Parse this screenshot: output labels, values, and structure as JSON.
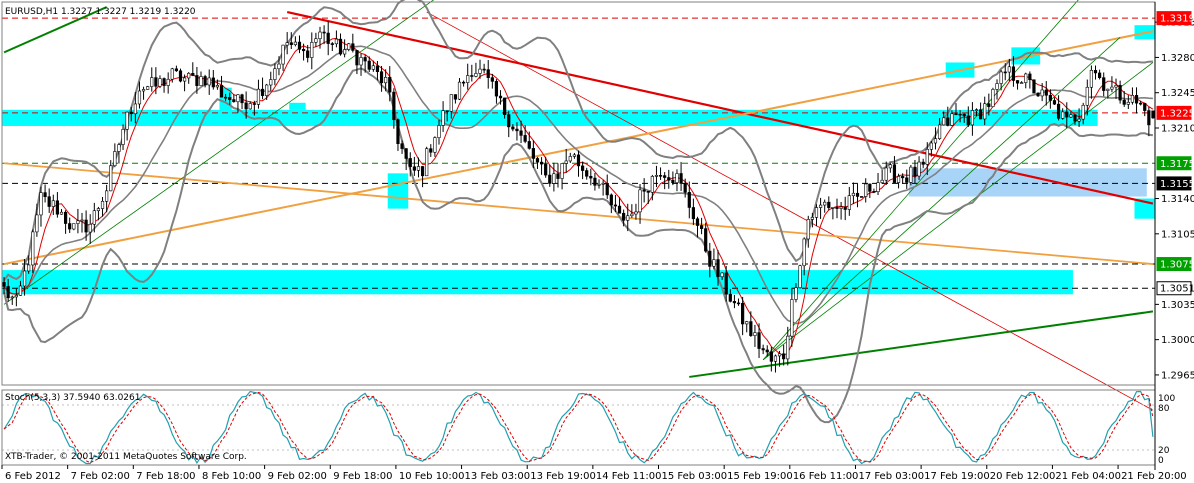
{
  "header": {
    "symbol_info": "EURUSD,H1 1.3227 1.3227 1.3219 1.3220"
  },
  "stoch_panel": {
    "label": "Stoch(5,3,3) 37.5940 63.0261",
    "levels": [
      "100",
      "80",
      "20",
      "0"
    ]
  },
  "copyright": "XTB-Trader, © 2001-2011 MetaQuotes Software Corp.",
  "colors": {
    "background": "#ffffff",
    "candle": "#000000",
    "bollinger": "#808080",
    "ma": "#e00000",
    "zone": "#00ffff",
    "zone_blue": "#a8d4f8",
    "trend_red": "#e00000",
    "trend_orange": "#f0a040",
    "trend_green": "#008000",
    "tag_red": "#ff0000",
    "tag_green": "#00a000",
    "tag_black": "#000000",
    "stoch_main": "#20a0b0",
    "stoch_signal": "#e00000"
  },
  "chart_data": {
    "type": "candlestick",
    "title": "EURUSD,H1",
    "x_axis": {
      "type": "time",
      "tick_labels": [
        "6 Feb 2012",
        "7 Feb 02:00",
        "7 Feb 18:00",
        "8 Feb 10:00",
        "9 Feb 02:00",
        "9 Feb 18:00",
        "10 Feb 10:00",
        "13 Feb 03:00",
        "13 Feb 19:00",
        "14 Feb 11:00",
        "15 Feb 03:00",
        "15 Feb 19:00",
        "16 Feb 11:00",
        "17 Feb 03:00",
        "17 Feb 19:00",
        "20 Feb 12:00",
        "21 Feb 04:00",
        "21 Feb 20:00"
      ],
      "ticks_per_label": 16
    },
    "y_axis": {
      "tick_labels": [
        "1.3315",
        "1.3280",
        "1.3245",
        "1.3210",
        "1.3140",
        "1.3105",
        "1.3035",
        "1.3000",
        "1.2965"
      ],
      "range": [
        1.2955,
        1.3335
      ]
    },
    "last": {
      "open": 1.3227,
      "high": 1.3227,
      "low": 1.3219,
      "close": 1.322
    },
    "price_markers": [
      {
        "label": "1.3319",
        "style": "red"
      },
      {
        "label": "1.3225",
        "style": "red"
      },
      {
        "label": "1.3175",
        "style": "green"
      },
      {
        "label": "1.3155",
        "style": "black"
      },
      {
        "label": "1.3075",
        "style": "green"
      },
      {
        "label": "1.3051",
        "style": "black-outline"
      }
    ],
    "horizontal_lines": [
      {
        "price": 1.3319,
        "color": "red",
        "style": "dashed"
      },
      {
        "price": 1.3225,
        "color": "red",
        "style": "dashed"
      },
      {
        "price": 1.3175,
        "color": "green",
        "style": "dashed"
      },
      {
        "price": 1.3155,
        "color": "black",
        "style": "dashed"
      },
      {
        "price": 1.3075,
        "color": "black",
        "style": "dashed"
      },
      {
        "price": 1.3051,
        "color": "black",
        "style": "dashed"
      }
    ],
    "zones": [
      {
        "from_bar": 0,
        "to_bar": 266,
        "low": 1.3212,
        "high": 1.3228,
        "color": "zone"
      },
      {
        "from_bar": 0,
        "to_bar": 260,
        "low": 1.3045,
        "high": 1.3069,
        "color": "zone"
      },
      {
        "from_bar": 221,
        "to_bar": 278,
        "low": 1.3142,
        "high": 1.317,
        "color": "zone_blue"
      },
      {
        "from_bar": 53,
        "to_bar": 55,
        "low": 1.3212,
        "high": 1.325,
        "color": "zone"
      },
      {
        "from_bar": 70,
        "to_bar": 73,
        "low": 1.3228,
        "high": 1.3235,
        "color": "zone"
      },
      {
        "from_bar": 94,
        "to_bar": 98,
        "low": 1.313,
        "high": 1.3165,
        "color": "zone"
      },
      {
        "from_bar": 230,
        "to_bar": 236,
        "low": 1.326,
        "high": 1.3275,
        "color": "zone"
      },
      {
        "from_bar": 246,
        "to_bar": 252,
        "low": 1.3273,
        "high": 1.329,
        "color": "zone"
      },
      {
        "from_bar": 276,
        "to_bar": 280,
        "low": 1.3298,
        "high": 1.3312,
        "color": "zone"
      },
      {
        "from_bar": 276,
        "to_bar": 280,
        "low": 1.312,
        "high": 1.314,
        "color": "zone"
      }
    ],
    "trend_lines": [
      {
        "b1": 69,
        "p1": 1.3325,
        "b2": 280,
        "p2": 1.3135,
        "color": "trend_red",
        "width": 2.2
      },
      {
        "b1": 103,
        "p1": 1.3325,
        "b2": 280,
        "p2": 1.293,
        "color": "trend_red",
        "width": 0.8
      },
      {
        "b1": 0,
        "p1": 1.3075,
        "b2": 280,
        "p2": 1.3306,
        "color": "trend_orange",
        "width": 2
      },
      {
        "b1": 0,
        "p1": 1.3175,
        "b2": 280,
        "p2": 1.3075,
        "color": "trend_orange",
        "width": 1.8
      },
      {
        "b1": 167,
        "p1": 1.2963,
        "b2": 280,
        "p2": 1.3028,
        "color": "trend_green",
        "width": 2
      },
      {
        "b1": 0,
        "p1": 1.3285,
        "b2": 25,
        "p2": 1.333,
        "color": "trend_green",
        "width": 2
      },
      {
        "b1": 0,
        "p1": 1.3035,
        "b2": 105,
        "p2": 1.3338,
        "color": "trend_green",
        "width": 0.8
      },
      {
        "b1": 185,
        "p1": 1.298,
        "b2": 262,
        "p2": 1.3338,
        "color": "trend_green",
        "width": 0.8
      },
      {
        "b1": 185,
        "p1": 1.298,
        "b2": 272,
        "p2": 1.33,
        "color": "trend_green",
        "width": 0.8
      },
      {
        "b1": 185,
        "p1": 1.298,
        "b2": 280,
        "p2": 1.3275,
        "color": "trend_green",
        "width": 0.8
      }
    ],
    "path_points": [
      [
        0,
        1.305
      ],
      [
        3,
        1.3035
      ],
      [
        6,
        1.308
      ],
      [
        9,
        1.314
      ],
      [
        13,
        1.313
      ],
      [
        17,
        1.311
      ],
      [
        21,
        1.3115
      ],
      [
        25,
        1.315
      ],
      [
        29,
        1.321
      ],
      [
        33,
        1.325
      ],
      [
        37,
        1.3252
      ],
      [
        41,
        1.3262
      ],
      [
        45,
        1.3258
      ],
      [
        49,
        1.326
      ],
      [
        53,
        1.3245
      ],
      [
        57,
        1.3235
      ],
      [
        61,
        1.324
      ],
      [
        65,
        1.3262
      ],
      [
        69,
        1.3295
      ],
      [
        73,
        1.3283
      ],
      [
        77,
        1.3305
      ],
      [
        81,
        1.329
      ],
      [
        85,
        1.3285
      ],
      [
        89,
        1.327
      ],
      [
        93,
        1.3255
      ],
      [
        96,
        1.32
      ],
      [
        99,
        1.3165
      ],
      [
        102,
        1.317
      ],
      [
        105,
        1.3205
      ],
      [
        108,
        1.323
      ],
      [
        111,
        1.325
      ],
      [
        114,
        1.327
      ],
      [
        117,
        1.3262
      ],
      [
        120,
        1.324
      ],
      [
        123,
        1.322
      ],
      [
        126,
        1.32
      ],
      [
        129,
        1.318
      ],
      [
        132,
        1.316
      ],
      [
        135,
        1.3165
      ],
      [
        138,
        1.3185
      ],
      [
        141,
        1.317
      ],
      [
        144,
        1.316
      ],
      [
        147,
        1.314
      ],
      [
        150,
        1.312
      ],
      [
        153,
        1.3125
      ],
      [
        156,
        1.315
      ],
      [
        160,
        1.317
      ],
      [
        164,
        1.316
      ],
      [
        168,
        1.3125
      ],
      [
        172,
        1.308
      ],
      [
        176,
        1.305
      ],
      [
        180,
        1.302
      ],
      [
        184,
        1.2995
      ],
      [
        187,
        1.2978
      ],
      [
        190,
        1.2985
      ],
      [
        193,
        1.306
      ],
      [
        196,
        1.312
      ],
      [
        200,
        1.3135
      ],
      [
        204,
        1.313
      ],
      [
        208,
        1.314
      ],
      [
        212,
        1.3155
      ],
      [
        216,
        1.3165
      ],
      [
        220,
        1.3162
      ],
      [
        224,
        1.317
      ],
      [
        228,
        1.321
      ],
      [
        232,
        1.3222
      ],
      [
        236,
        1.322
      ],
      [
        240,
        1.3235
      ],
      [
        244,
        1.3265
      ],
      [
        248,
        1.326
      ],
      [
        252,
        1.3245
      ],
      [
        256,
        1.323
      ],
      [
        259,
        1.3215
      ],
      [
        262,
        1.3225
      ],
      [
        265,
        1.327
      ],
      [
        268,
        1.3255
      ],
      [
        271,
        1.3245
      ],
      [
        274,
        1.324
      ],
      [
        277,
        1.3232
      ],
      [
        279,
        1.322
      ]
    ],
    "series": [
      {
        "name": "MA",
        "type": "line",
        "color": "ma"
      },
      {
        "name": "Bollinger Bands",
        "type": "band",
        "color": "bollinger"
      }
    ],
    "stochastic": {
      "k": 37.594,
      "d": 63.0261,
      "levels": [
        20,
        80
      ],
      "range": [
        0,
        100
      ]
    }
  }
}
